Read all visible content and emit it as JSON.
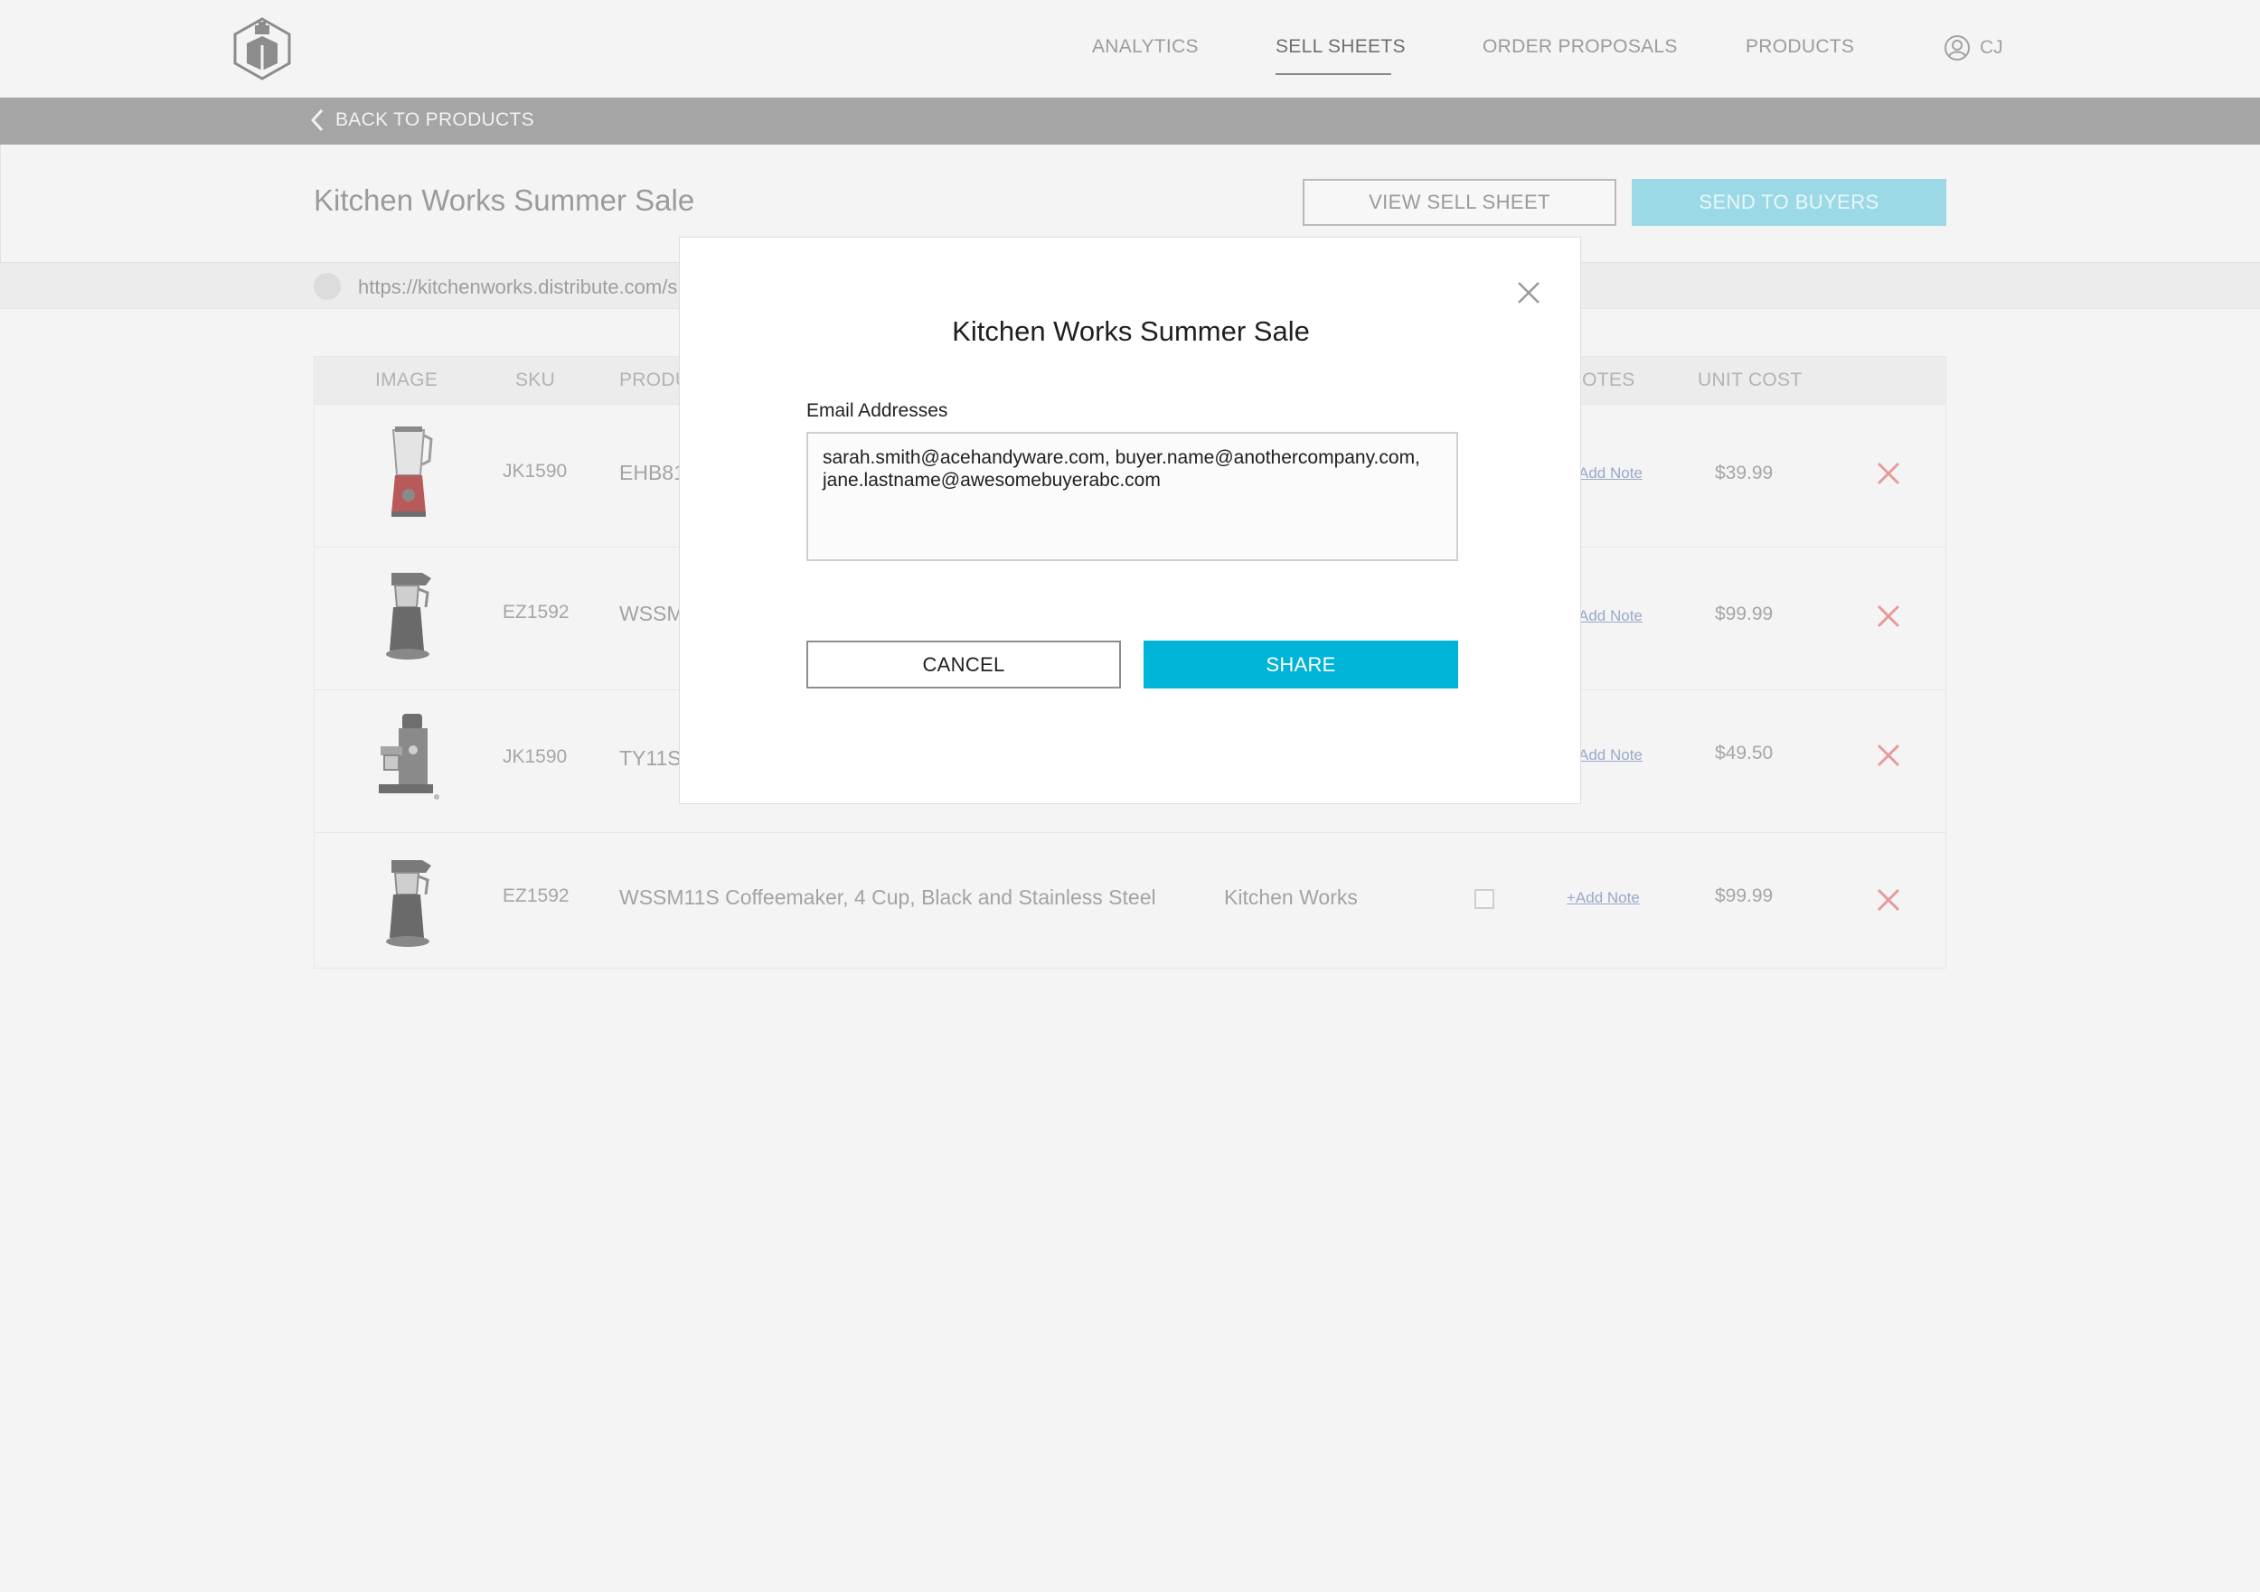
{
  "nav": {
    "items": [
      {
        "label": "ANALYTICS",
        "active": false
      },
      {
        "label": "SELL SHEETS",
        "active": true
      },
      {
        "label": "ORDER PROPOSALS",
        "active": false
      },
      {
        "label": "PRODUCTS",
        "active": false
      }
    ],
    "user_initials": "CJ"
  },
  "backbar": {
    "label": "BACK TO PRODUCTS"
  },
  "header": {
    "title": "Kitchen Works Summer Sale",
    "view_button": "VIEW SELL SHEET",
    "send_button": "SEND TO BUYERS",
    "url": "https://kitchenworks.distribute.com/s"
  },
  "table": {
    "headers": {
      "image": "IMAGE",
      "sku": "SKU",
      "product": "PRODU",
      "notes": "IOTES",
      "unit_cost": "UNIT COST"
    },
    "rows": [
      {
        "sku": "JK1590",
        "name": "EHB81",
        "brand": "",
        "note": "Add Note",
        "price": "$39.99",
        "image": "blender-red"
      },
      {
        "sku": "EZ1592",
        "name": "WSSM",
        "brand": "",
        "note": "Add Note",
        "price": "$99.99",
        "image": "coffeemaker"
      },
      {
        "sku": "JK1590",
        "name": "TY11S",
        "brand": "",
        "note": "Add Note",
        "price": "$49.50",
        "image": "espresso-machine"
      },
      {
        "sku": "EZ1592",
        "name": "WSSM11S Coffeemaker, 4 Cup, Black and Stainless Steel",
        "brand": "Kitchen Works",
        "note": "+Add Note",
        "price": "$99.99",
        "image": "coffeemaker"
      }
    ]
  },
  "modal": {
    "title": "Kitchen Works Summer Sale",
    "email_label": "Email Addresses",
    "emails_value": "sarah.smith@acehandyware.com, buyer.name@anothercompany.com, jane.lastname@awesomebuyerabc.com",
    "cancel": "CANCEL",
    "share": "SHARE"
  },
  "colors": {
    "accent": "#00b4d8",
    "accent_faded": "#9cd9e6",
    "delete": "#e79a9a",
    "backbar": "#a5a5a5"
  }
}
